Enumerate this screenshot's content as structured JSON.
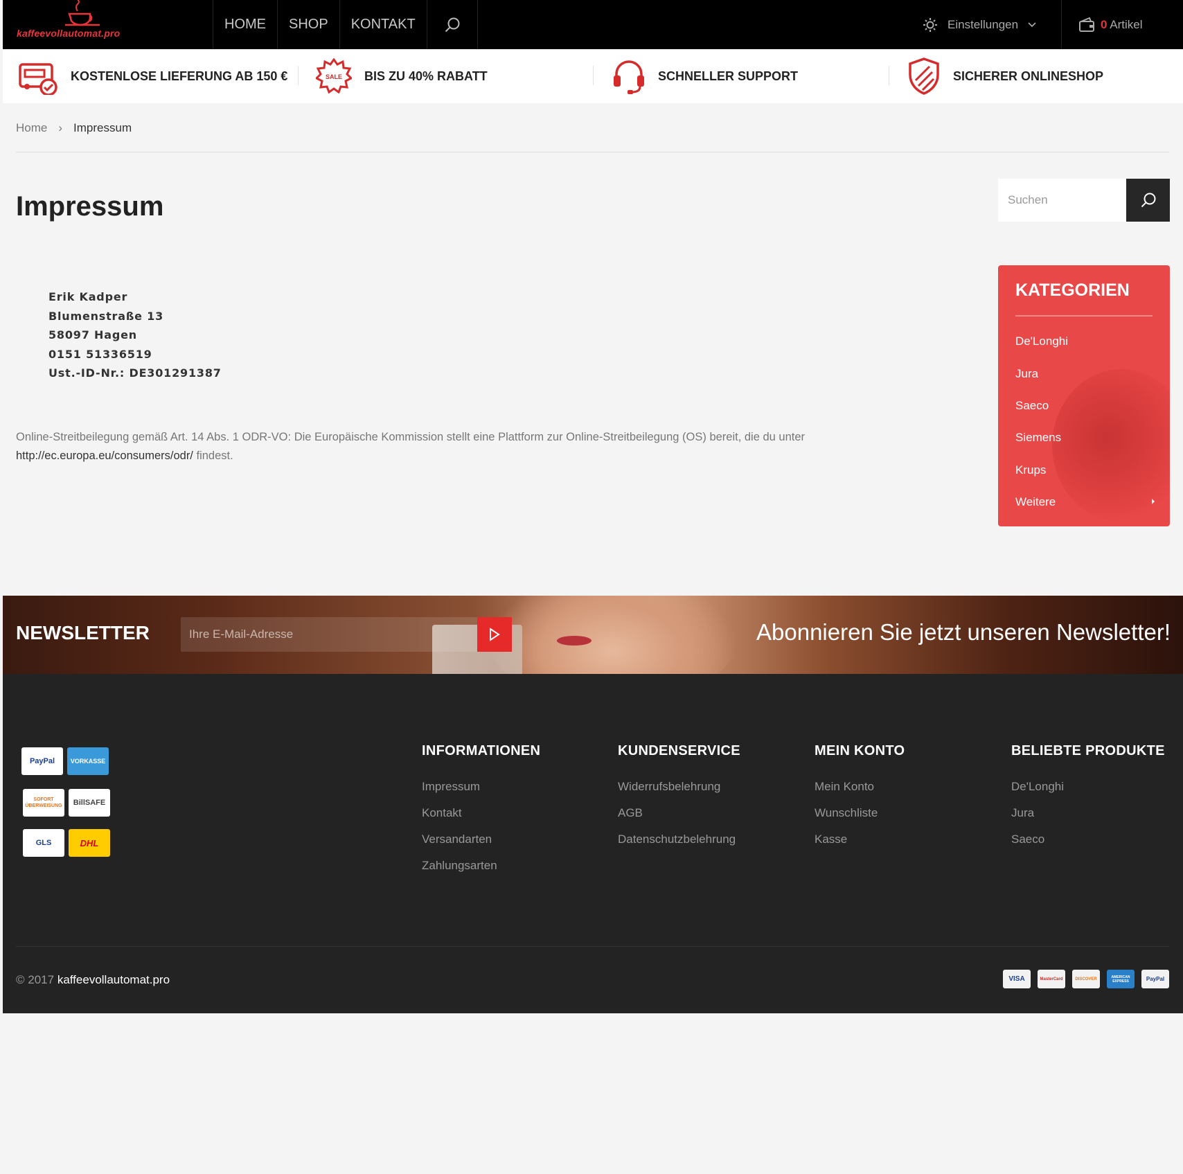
{
  "header": {
    "logo_text": "kaffeevollautomat.pro",
    "nav": [
      "HOME",
      "SHOP",
      "KONTAKT"
    ],
    "settings_label": "Einstellungen",
    "cart_count": "0",
    "cart_label": "Artikel"
  },
  "features": [
    {
      "label": "KOSTENLOSE LIEFERUNG AB 150 €",
      "icon": "delivery-truck-icon"
    },
    {
      "label": "BIS ZU 40% RABATT",
      "icon": "sale-badge-icon"
    },
    {
      "label": "SCHNELLER SUPPORT",
      "icon": "headset-icon"
    },
    {
      "label": "SICHERER ONLINESHOP",
      "icon": "shield-icon"
    }
  ],
  "breadcrumb": {
    "home": "Home",
    "current": "Impressum"
  },
  "page": {
    "title": "Impressum",
    "address": [
      "Erik Kadper",
      "Blumenstraße 13",
      "58097 Hagen",
      "0151 51336519",
      "Ust.-ID-Nr.: DE301291387"
    ],
    "odr_text": "Online-Streitbeilegung gemäß Art. 14 Abs. 1 ODR-VO: Die Europäische Kommission stellt eine Plattform zur Online-Streitbeilegung (OS) bereit, die du unter",
    "odr_link": "http://ec.europa.eu/consumers/odr/",
    "odr_suffix": "findest."
  },
  "sidebar": {
    "search_placeholder": "Suchen",
    "categories_title": "KATEGORIEN",
    "categories": [
      "De'Longhi",
      "Jura",
      "Saeco",
      "Siemens",
      "Krups",
      "Weitere"
    ]
  },
  "newsletter": {
    "title": "NEWSLETTER",
    "placeholder": "Ihre E-Mail-Adresse",
    "slogan": "Abonnieren Sie jetzt unseren Newsletter!"
  },
  "footer": {
    "payment_logos": [
      "PayPal",
      "VORKASSE",
      "SOFORT ÜBERWEISUNG",
      "BillSAFE",
      "GLS",
      "DHL"
    ],
    "columns": [
      {
        "title": "INFORMATIONEN",
        "items": [
          "Impressum",
          "Kontakt",
          "Versandarten",
          "Zahlungsarten"
        ]
      },
      {
        "title": "KUNDENSERVICE",
        "items": [
          "Widerrufsbelehrung",
          "AGB",
          "Datenschutzbelehrung"
        ]
      },
      {
        "title": "MEIN KONTO",
        "items": [
          "Mein Konto",
          "Wunschliste",
          "Kasse"
        ]
      },
      {
        "title": "BELIEBTE PRODUKTE",
        "items": [
          "De'Longhi",
          "Jura",
          "Saeco"
        ]
      }
    ],
    "copyright_prefix": "© 2017",
    "copyright_brand": "kaffeevollautomat.pro",
    "cards": [
      "VISA",
      "MasterCard",
      "DISCOVER",
      "AMERICAN EXPRESS",
      "PayPal"
    ]
  },
  "colors": {
    "accent": "#e94848",
    "header_bg": "#000000",
    "footer_bg": "#232323"
  }
}
